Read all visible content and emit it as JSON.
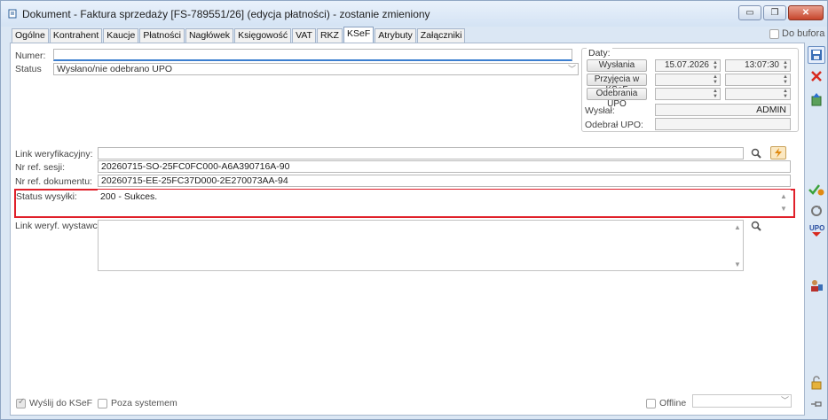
{
  "window": {
    "title": "Dokument - Faktura sprzedaży [FS-789551/26] (edycja płatności) - zostanie zmieniony",
    "buttons": {
      "minimize": "▭",
      "restore": "❐",
      "close": "✕"
    }
  },
  "tabs": [
    {
      "label": "Ogólne"
    },
    {
      "label": "Kontrahent"
    },
    {
      "label": "Kaucje"
    },
    {
      "label": "Płatności"
    },
    {
      "label": "Nagłówek"
    },
    {
      "label": "Księgowość"
    },
    {
      "label": "VAT"
    },
    {
      "label": "RKZ"
    },
    {
      "label": "KSeF",
      "active": true
    },
    {
      "label": "Atrybuty"
    },
    {
      "label": "Załączniki"
    }
  ],
  "do_bufora": {
    "label": "Do bufora",
    "checked": false
  },
  "form": {
    "numer_label": "Numer:",
    "numer_value": "",
    "status_label": "Status",
    "status_value": "Wysłano/nie odebrano UPO",
    "daty": {
      "title": "Daty:",
      "wyslania_label": "Wysłania",
      "wyslania_date": "15.07.2026",
      "wyslania_time": "13:07:30",
      "przyjecia_label": "Przyjęcia w KSeF",
      "przyjecia_date": "",
      "przyjecia_time": "",
      "odebrania_label": "Odebrania UPO",
      "odebrania_date": "",
      "odebrania_time": "",
      "wyslal_label": "Wysłał:",
      "wyslal_value": "ADMIN",
      "odebral_label": "Odebrał UPO:",
      "odebral_value": ""
    },
    "link_weryf_label": "Link weryfikacyjny:",
    "link_weryf_value": "",
    "nr_ref_sesji_label": "Nr ref. sesji:",
    "nr_ref_sesji_value": "20260715-SO-25FC0FC000-A6A390716A-90",
    "nr_ref_dok_label": "Nr ref. dokumentu:",
    "nr_ref_dok_value": "20260715-EE-25FC37D000-2E270073AA-94",
    "status_wysylki_label": "Status wysyłki:",
    "status_wysylki_value": "200 - Sukces.",
    "link_weryf_wyst_label": "Link weryf. wystawcy:",
    "link_weryf_wyst_value": ""
  },
  "bottom": {
    "wyslij_label": "Wyślij do KSeF",
    "wyslij_checked": true,
    "poza_label": "Poza systemem",
    "poza_checked": false,
    "offline_label": "Offline",
    "offline_checked": false,
    "offline_select": ""
  },
  "toolbar_icons": [
    "save-icon",
    "delete-icon",
    "export-icon",
    "approve-icon",
    "refresh-ksef-icon",
    "upo-icon",
    "contractor-icon",
    "lock-icon",
    "pin-icon"
  ],
  "colors": {
    "highlight": "#e0202a",
    "accent": "#2b5f9a"
  }
}
